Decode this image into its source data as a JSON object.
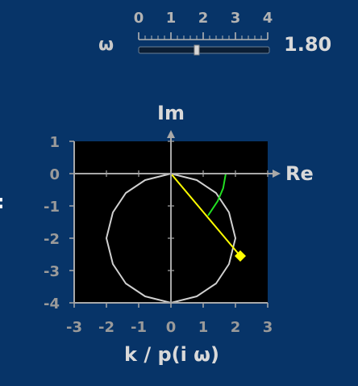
{
  "slider": {
    "label": "ω",
    "value": 1.8,
    "value_text": "1.80",
    "min": 0,
    "max": 4,
    "tick_labels": [
      "0",
      "1",
      "2",
      "3",
      "4"
    ]
  },
  "left_glyph": ":",
  "chart_data": {
    "type": "line",
    "title": "",
    "xlabel": "k / p(i ω)",
    "ylabel": "",
    "x_axis_name": "Re",
    "y_axis_name": "Im",
    "xlim": [
      -3,
      3
    ],
    "ylim": [
      -4,
      1
    ],
    "x_ticks": [
      "-3",
      "-2",
      "-1",
      "0",
      "1",
      "2",
      "3"
    ],
    "y_ticks": [
      "1",
      "0",
      "-1",
      "-2",
      "-3",
      "-4"
    ],
    "grid": false,
    "background": "#000000",
    "series": [
      {
        "id": "nyquist-circle",
        "color": "#d0d0d0",
        "points": [
          [
            0,
            0
          ],
          [
            0.8,
            -0.2
          ],
          [
            1.4,
            -0.6
          ],
          [
            1.8,
            -1.2
          ],
          [
            2.0,
            -2.0
          ],
          [
            1.8,
            -2.8
          ],
          [
            1.4,
            -3.4
          ],
          [
            0.8,
            -3.8
          ],
          [
            0,
            -4
          ],
          [
            -0.8,
            -3.8
          ],
          [
            -1.4,
            -3.4
          ],
          [
            -1.8,
            -2.8
          ],
          [
            -2.0,
            -2.0
          ],
          [
            -1.8,
            -1.2
          ],
          [
            -1.4,
            -0.6
          ],
          [
            -0.8,
            -0.2
          ],
          [
            0,
            0
          ]
        ]
      },
      {
        "id": "traced-arc",
        "color": "#22e022",
        "points": [
          [
            1.7,
            0
          ],
          [
            1.62,
            -0.45
          ],
          [
            1.45,
            -0.85
          ],
          [
            1.15,
            -1.3
          ]
        ]
      },
      {
        "id": "vector",
        "color": "#ffff00",
        "points": [
          [
            0,
            0
          ],
          [
            2.15,
            -2.55
          ]
        ]
      }
    ],
    "marker": {
      "x": 2.15,
      "y": -2.55,
      "color": "#ffff00"
    }
  }
}
